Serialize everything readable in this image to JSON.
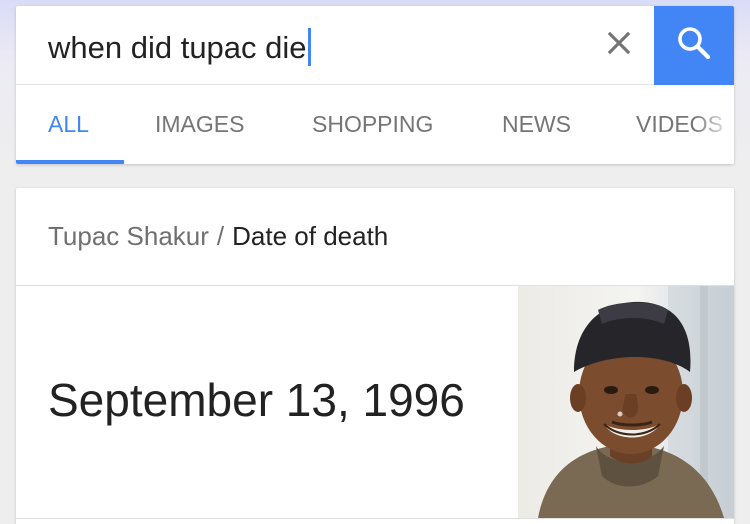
{
  "search": {
    "query": "when did tupac die",
    "clear_icon": "close-icon",
    "search_icon": "search-icon",
    "button_color": "#4285f4"
  },
  "tabs": [
    {
      "label": "ALL",
      "active": true
    },
    {
      "label": "IMAGES",
      "active": false
    },
    {
      "label": "SHOPPING",
      "active": false
    },
    {
      "label": "NEWS",
      "active": false
    },
    {
      "label": "VIDEOS",
      "active": false
    }
  ],
  "result": {
    "entity": "Tupac Shakur",
    "separator": "/",
    "attribute": "Date of death",
    "answer": "September 13, 1996",
    "image_icon": "person-photo"
  },
  "colors": {
    "accent": "#4285f4",
    "text_primary": "#222222",
    "text_secondary": "#707070"
  }
}
